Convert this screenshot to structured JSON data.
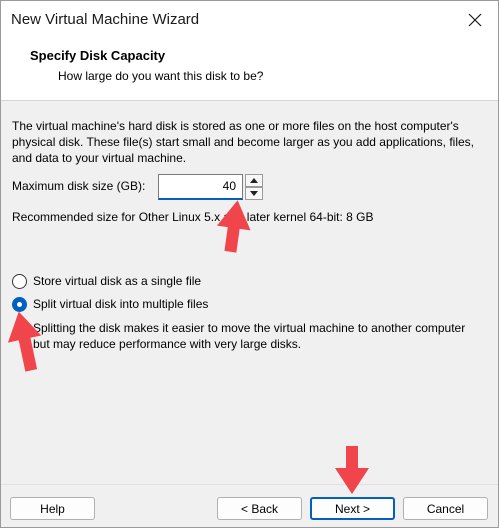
{
  "window": {
    "title": "New Virtual Machine Wizard"
  },
  "header": {
    "title": "Specify Disk Capacity",
    "subtitle": "How large do you want this disk to be?"
  },
  "body": {
    "description": "The virtual machine's hard disk is stored as one or more files on the host computer's physical disk. These file(s) start small and become larger as you add applications, files, and data to your virtual machine.",
    "max_size_label": "Maximum disk size (GB):",
    "max_size_value": "40",
    "recommended": "Recommended size for Other Linux 5.x and later kernel 64-bit: 8 GB"
  },
  "options": {
    "single_file": {
      "label": "Store virtual disk as a single file",
      "checked": false
    },
    "split_files": {
      "label": "Split virtual disk into multiple files",
      "checked": true
    },
    "split_description": "Splitting the disk makes it easier to move the virtual machine to another computer but may reduce performance with very large disks."
  },
  "buttons": {
    "help": "Help",
    "back": "< Back",
    "next": "Next >",
    "cancel": "Cancel"
  },
  "colors": {
    "accent": "#0060c0",
    "annotation_arrow": "#f0454a"
  },
  "icons": {
    "close": "close-icon",
    "spin_up": "chevron-up-icon",
    "spin_down": "chevron-down-icon",
    "annotation": "red-arrow-icon"
  }
}
